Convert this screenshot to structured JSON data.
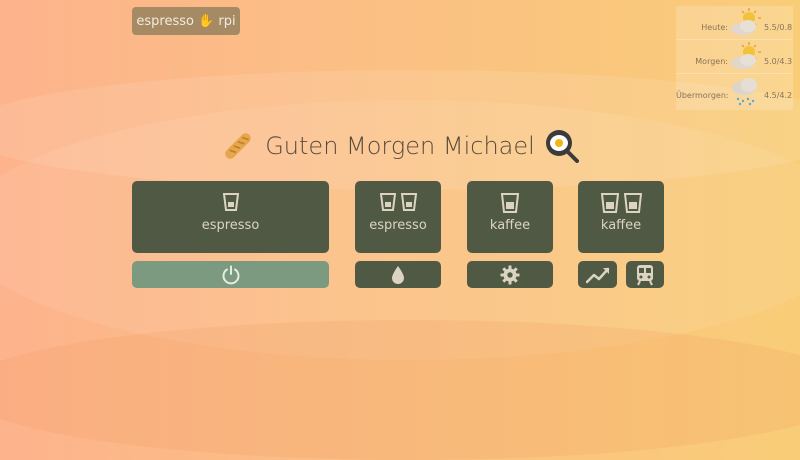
{
  "host": {
    "label": "espresso ✋ rpi"
  },
  "weather": [
    {
      "day": "Heute:",
      "temp": "5.5/0.8",
      "icon": "sun-cloud-icon"
    },
    {
      "day": "Morgen:",
      "temp": "5.0/4.3",
      "icon": "sun-cloud-icon"
    },
    {
      "day": "Übermorgen:",
      "temp": "4.5/4.2",
      "icon": "rain-cloud-icon"
    }
  ],
  "greeting": {
    "text": "Guten Morgen Michael",
    "left_icon": "baguette-icon",
    "right_icon": "fried-egg-pan-icon"
  },
  "buttons": [
    {
      "label": "espresso",
      "cups": 1
    },
    {
      "label": "espresso",
      "cups": 2
    },
    {
      "label": "kaffee",
      "cups": 1
    },
    {
      "label": "kaffee",
      "cups": 2
    }
  ],
  "actions": [
    {
      "icon": "power-icon"
    },
    {
      "icon": "water-drop-icon"
    },
    {
      "icon": "gear-icon"
    },
    {
      "icon": "chart-line-icon"
    },
    {
      "icon": "train-icon"
    }
  ],
  "colors": {
    "button": "#505944",
    "power_button": "#7b9a80",
    "icon": "#dcd4c3",
    "badge": "#a58a63"
  }
}
